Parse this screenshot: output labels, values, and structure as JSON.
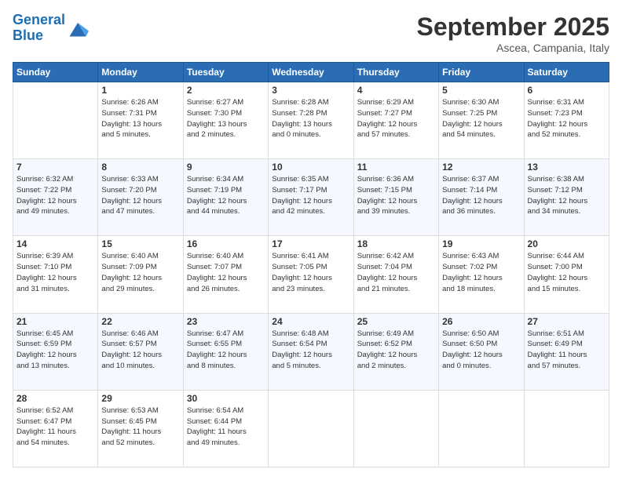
{
  "logo": {
    "line1": "General",
    "line2": "Blue"
  },
  "title": "September 2025",
  "location": "Ascea, Campania, Italy",
  "days_of_week": [
    "Sunday",
    "Monday",
    "Tuesday",
    "Wednesday",
    "Thursday",
    "Friday",
    "Saturday"
  ],
  "weeks": [
    [
      {
        "day": "",
        "info": ""
      },
      {
        "day": "1",
        "info": "Sunrise: 6:26 AM\nSunset: 7:31 PM\nDaylight: 13 hours\nand 5 minutes."
      },
      {
        "day": "2",
        "info": "Sunrise: 6:27 AM\nSunset: 7:30 PM\nDaylight: 13 hours\nand 2 minutes."
      },
      {
        "day": "3",
        "info": "Sunrise: 6:28 AM\nSunset: 7:28 PM\nDaylight: 13 hours\nand 0 minutes."
      },
      {
        "day": "4",
        "info": "Sunrise: 6:29 AM\nSunset: 7:27 PM\nDaylight: 12 hours\nand 57 minutes."
      },
      {
        "day": "5",
        "info": "Sunrise: 6:30 AM\nSunset: 7:25 PM\nDaylight: 12 hours\nand 54 minutes."
      },
      {
        "day": "6",
        "info": "Sunrise: 6:31 AM\nSunset: 7:23 PM\nDaylight: 12 hours\nand 52 minutes."
      }
    ],
    [
      {
        "day": "7",
        "info": "Sunrise: 6:32 AM\nSunset: 7:22 PM\nDaylight: 12 hours\nand 49 minutes."
      },
      {
        "day": "8",
        "info": "Sunrise: 6:33 AM\nSunset: 7:20 PM\nDaylight: 12 hours\nand 47 minutes."
      },
      {
        "day": "9",
        "info": "Sunrise: 6:34 AM\nSunset: 7:19 PM\nDaylight: 12 hours\nand 44 minutes."
      },
      {
        "day": "10",
        "info": "Sunrise: 6:35 AM\nSunset: 7:17 PM\nDaylight: 12 hours\nand 42 minutes."
      },
      {
        "day": "11",
        "info": "Sunrise: 6:36 AM\nSunset: 7:15 PM\nDaylight: 12 hours\nand 39 minutes."
      },
      {
        "day": "12",
        "info": "Sunrise: 6:37 AM\nSunset: 7:14 PM\nDaylight: 12 hours\nand 36 minutes."
      },
      {
        "day": "13",
        "info": "Sunrise: 6:38 AM\nSunset: 7:12 PM\nDaylight: 12 hours\nand 34 minutes."
      }
    ],
    [
      {
        "day": "14",
        "info": "Sunrise: 6:39 AM\nSunset: 7:10 PM\nDaylight: 12 hours\nand 31 minutes."
      },
      {
        "day": "15",
        "info": "Sunrise: 6:40 AM\nSunset: 7:09 PM\nDaylight: 12 hours\nand 29 minutes."
      },
      {
        "day": "16",
        "info": "Sunrise: 6:40 AM\nSunset: 7:07 PM\nDaylight: 12 hours\nand 26 minutes."
      },
      {
        "day": "17",
        "info": "Sunrise: 6:41 AM\nSunset: 7:05 PM\nDaylight: 12 hours\nand 23 minutes."
      },
      {
        "day": "18",
        "info": "Sunrise: 6:42 AM\nSunset: 7:04 PM\nDaylight: 12 hours\nand 21 minutes."
      },
      {
        "day": "19",
        "info": "Sunrise: 6:43 AM\nSunset: 7:02 PM\nDaylight: 12 hours\nand 18 minutes."
      },
      {
        "day": "20",
        "info": "Sunrise: 6:44 AM\nSunset: 7:00 PM\nDaylight: 12 hours\nand 15 minutes."
      }
    ],
    [
      {
        "day": "21",
        "info": "Sunrise: 6:45 AM\nSunset: 6:59 PM\nDaylight: 12 hours\nand 13 minutes."
      },
      {
        "day": "22",
        "info": "Sunrise: 6:46 AM\nSunset: 6:57 PM\nDaylight: 12 hours\nand 10 minutes."
      },
      {
        "day": "23",
        "info": "Sunrise: 6:47 AM\nSunset: 6:55 PM\nDaylight: 12 hours\nand 8 minutes."
      },
      {
        "day": "24",
        "info": "Sunrise: 6:48 AM\nSunset: 6:54 PM\nDaylight: 12 hours\nand 5 minutes."
      },
      {
        "day": "25",
        "info": "Sunrise: 6:49 AM\nSunset: 6:52 PM\nDaylight: 12 hours\nand 2 minutes."
      },
      {
        "day": "26",
        "info": "Sunrise: 6:50 AM\nSunset: 6:50 PM\nDaylight: 12 hours\nand 0 minutes."
      },
      {
        "day": "27",
        "info": "Sunrise: 6:51 AM\nSunset: 6:49 PM\nDaylight: 11 hours\nand 57 minutes."
      }
    ],
    [
      {
        "day": "28",
        "info": "Sunrise: 6:52 AM\nSunset: 6:47 PM\nDaylight: 11 hours\nand 54 minutes."
      },
      {
        "day": "29",
        "info": "Sunrise: 6:53 AM\nSunset: 6:45 PM\nDaylight: 11 hours\nand 52 minutes."
      },
      {
        "day": "30",
        "info": "Sunrise: 6:54 AM\nSunset: 6:44 PM\nDaylight: 11 hours\nand 49 minutes."
      },
      {
        "day": "",
        "info": ""
      },
      {
        "day": "",
        "info": ""
      },
      {
        "day": "",
        "info": ""
      },
      {
        "day": "",
        "info": ""
      }
    ]
  ]
}
